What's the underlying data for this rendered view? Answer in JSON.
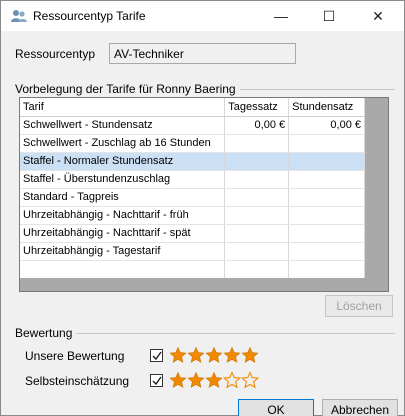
{
  "window": {
    "title": "Ressourcentyp Tarife",
    "controls": {
      "minimize": "—",
      "maximize": "☐",
      "close": "✕"
    }
  },
  "ressourcentyp": {
    "label": "Ressourcentyp",
    "value": "AV-Techniker"
  },
  "tarife_group": {
    "title": "Vorbelegung der Tarife für Ronny Baering",
    "columns": [
      "Tarif",
      "Tagessatz",
      "Stundensatz"
    ],
    "rows": [
      {
        "tarif": "Schwellwert - Stundensatz",
        "tagessatz": "0,00 €",
        "stundensatz": "0,00 €",
        "selected": false
      },
      {
        "tarif": "Schwellwert - Zuschlag ab 16 Stunden",
        "tagessatz": "",
        "stundensatz": "",
        "selected": false
      },
      {
        "tarif": "Staffel - Normaler Stundensatz",
        "tagessatz": "",
        "stundensatz": "",
        "selected": true
      },
      {
        "tarif": "Staffel - Überstundenzuschlag",
        "tagessatz": "",
        "stundensatz": "",
        "selected": false
      },
      {
        "tarif": "Standard - Tagpreis",
        "tagessatz": "",
        "stundensatz": "",
        "selected": false
      },
      {
        "tarif": "Uhrzeitabhängig - Nachttarif - früh",
        "tagessatz": "",
        "stundensatz": "",
        "selected": false
      },
      {
        "tarif": "Uhrzeitabhängig - Nachttarif - spät",
        "tagessatz": "",
        "stundensatz": "",
        "selected": false
      },
      {
        "tarif": "Uhrzeitabhängig - Tagestarif",
        "tagessatz": "",
        "stundensatz": "",
        "selected": false
      }
    ],
    "delete_button": "Löschen"
  },
  "bewertung": {
    "title": "Bewertung",
    "rows": [
      {
        "label": "Unsere Bewertung",
        "checked": true,
        "stars": 5,
        "max": 5
      },
      {
        "label": "Selbsteinschätzung",
        "checked": true,
        "stars": 3,
        "max": 5
      }
    ]
  },
  "footer": {
    "ok": "OK",
    "cancel": "Abbrechen"
  },
  "colors": {
    "star_filled": "#f28a00",
    "star_empty_outline": "#f28a00",
    "selected_row": "#cce0f5",
    "grid_background": "#a9a9a9"
  }
}
